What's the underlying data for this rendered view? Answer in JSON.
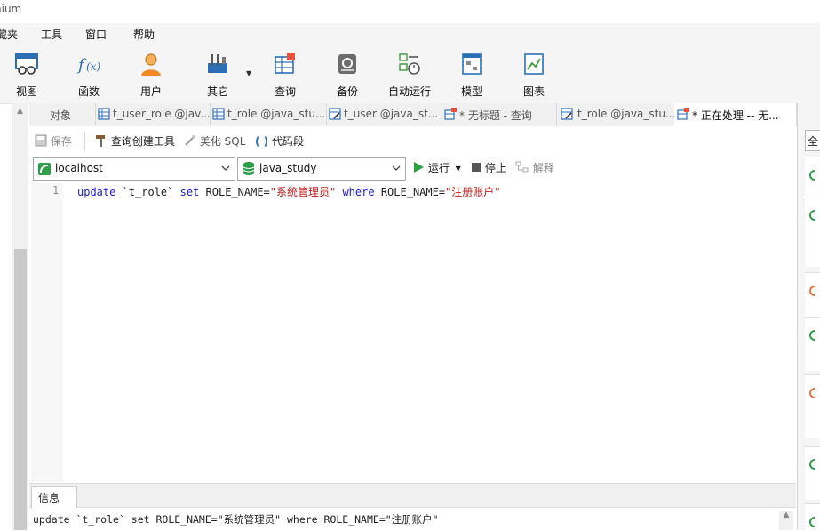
{
  "window": {
    "title_fragment": "nium"
  },
  "menu": [
    "藏夹",
    "工具",
    "窗口",
    "帮助"
  ],
  "toolbar": [
    {
      "label": "视图",
      "icon": "view-icon"
    },
    {
      "label": "函数",
      "icon": "function-icon"
    },
    {
      "label": "用户",
      "icon": "user-icon"
    },
    {
      "label": "其它",
      "icon": "tools-icon"
    },
    {
      "label": "查询",
      "icon": "query-icon"
    },
    {
      "label": "备份",
      "icon": "backup-icon"
    },
    {
      "label": "自动运行",
      "icon": "schedule-icon"
    },
    {
      "label": "模型",
      "icon": "model-icon"
    },
    {
      "label": "图表",
      "icon": "chart-icon"
    }
  ],
  "tabs": [
    {
      "label": "对象",
      "icon": ""
    },
    {
      "label": "t_user_role @jav...",
      "icon": "table-icon"
    },
    {
      "label": "t_role @java_stu...",
      "icon": "table-icon"
    },
    {
      "label": "t_user @java_st...",
      "icon": "table-edit-icon"
    },
    {
      "label": "* 无标题 - 查询",
      "icon": "query-icon"
    },
    {
      "label": "t_role @java_stu...",
      "icon": "table-edit-icon"
    },
    {
      "label": "* 正在处理 -- 无...",
      "icon": "query-icon"
    }
  ],
  "query_toolbar": {
    "save": "保存",
    "builder": "查询创建工具",
    "beautify": "美化 SQL",
    "snippet": "代码段"
  },
  "connection": {
    "server": "localhost",
    "database": "java_study"
  },
  "run_bar": {
    "run": "运行",
    "stop": "停止",
    "explain": "解释"
  },
  "editor": {
    "line_number": "1",
    "tokens": {
      "kw_update": "update",
      "table": " `t_role` ",
      "kw_set": "set",
      "col1": " ROLE_NAME=",
      "val1": "\"系统管理员\"",
      "kw_where": " where",
      "col2": " ROLE_NAME=",
      "val2": "\"注册账户\""
    }
  },
  "info_panel": {
    "tab": "信息",
    "message": "update `t_role` set ROLE_NAME=\"系统管理员\" where ROLE_NAME=\"注册账户\""
  },
  "right_panel": {
    "button": "全"
  },
  "colors": {
    "keyword": "#2020c0",
    "string": "#c02020",
    "run_green": "#2ea043"
  }
}
